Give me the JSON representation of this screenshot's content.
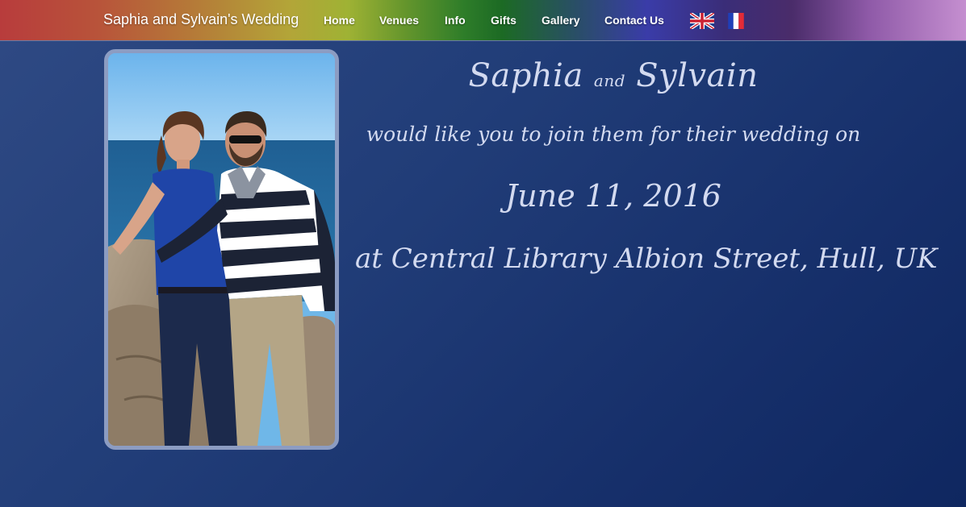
{
  "brand": "Saphia and Sylvain's Wedding",
  "nav": {
    "home": "Home",
    "venues": "Venues",
    "info": "Info",
    "gifts": "Gifts",
    "gallery": "Gallery",
    "contact": "Contact Us"
  },
  "languages": {
    "english_icon": "uk-flag-icon",
    "french_icon": "france-flag-icon"
  },
  "invitation": {
    "bride": "Saphia",
    "and": "and",
    "groom": "Sylvain",
    "join_line": "would like you to join them for their wedding on",
    "date": "June 11, 2016",
    "venue_line": "at Central Library Albion Street, Hull, UK"
  },
  "colors": {
    "background": "#213d78",
    "invitation_text": "#d3daf0",
    "photo_border": "#8c9cc2"
  }
}
